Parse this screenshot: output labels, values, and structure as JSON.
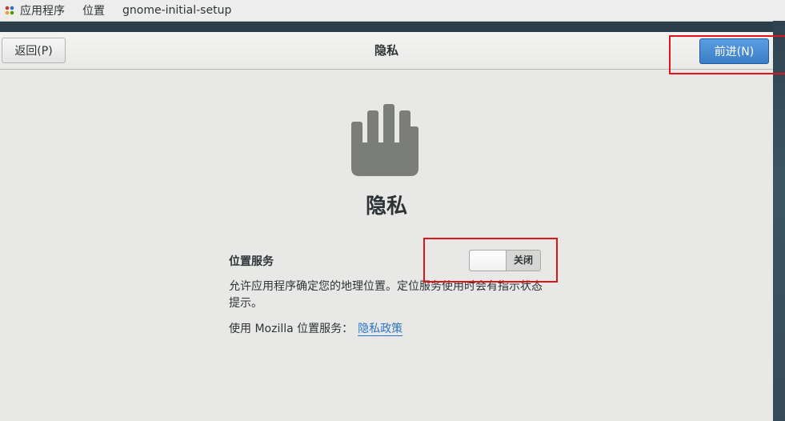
{
  "topbar": {
    "applications": "应用程序",
    "places": "位置",
    "app_name": "gnome-initial-setup"
  },
  "header": {
    "back_label": "返回(P)",
    "title": "隐私",
    "next_label": "前进(N)"
  },
  "main": {
    "heading": "隐私",
    "location_services_label": "位置服务",
    "switch_state": "关闭",
    "description": "允许应用程序确定您的地理位置。定位服务使用时会有指示状态提示。",
    "usage_prefix": "使用 Mozilla 位置服务：",
    "policy_link": "隐私政策"
  },
  "icons": {
    "apps": "apps-icon",
    "privacy": "hand-icon"
  },
  "colors": {
    "accent": "#3c7fc8",
    "link": "#2a76c6",
    "highlight": "#e0141b"
  }
}
